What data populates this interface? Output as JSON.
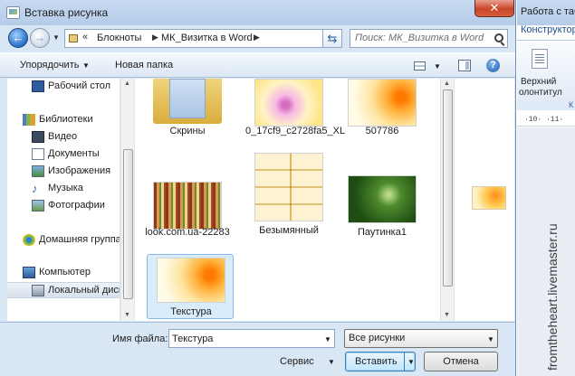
{
  "dialog": {
    "title": "Вставка рисунка",
    "close_label": "✕"
  },
  "address": {
    "prefix": "«",
    "crumbs": [
      "Блокноты",
      "МК_Визитка в Word"
    ],
    "search_placeholder": "Поиск: МК_Визитка в Word"
  },
  "toolbar": {
    "organize_label": "Упорядочить",
    "new_folder_label": "Новая папка",
    "help_label": "?"
  },
  "nav": {
    "items": [
      {
        "label": "Рабочий стол",
        "icon": "desktop-icon"
      },
      {
        "label": "Библиотеки",
        "icon": "libraries-icon"
      },
      {
        "label": "Видео",
        "icon": "video-icon"
      },
      {
        "label": "Документы",
        "icon": "documents-icon"
      },
      {
        "label": "Изображения",
        "icon": "images-icon"
      },
      {
        "label": "Музыка",
        "icon": "music-icon"
      },
      {
        "label": "Фотографии",
        "icon": "photos-icon"
      },
      {
        "label": "Домашняя группа",
        "icon": "homegroup-icon"
      },
      {
        "label": "Компьютер",
        "icon": "computer-icon"
      },
      {
        "label": "Локальный диск",
        "icon": "disk-icon"
      }
    ]
  },
  "files": [
    {
      "name": "Скрины",
      "kind": "folder"
    },
    {
      "name": "0_17cf9_c2728fa5_XL",
      "kind": "image-flowers"
    },
    {
      "name": "507786",
      "kind": "image-orange"
    },
    {
      "name": "look.com.ua-22283",
      "kind": "image-stripes"
    },
    {
      "name": "Безымянный",
      "kind": "image-cards"
    },
    {
      "name": "Паутинка1",
      "kind": "image-green"
    },
    {
      "name": "Текстура",
      "kind": "image-orange",
      "selected": true
    }
  ],
  "bottom": {
    "filename_label": "Имя файла:",
    "filename_value": "Текстура",
    "filetype_value": "Все рисунки",
    "service_label": "Сервис",
    "insert_label": "Вставить",
    "cancel_label": "Отмена"
  },
  "word": {
    "title": "Работа с таб",
    "tab": "Конструктор",
    "cmd1": "Верхний",
    "cmd2": "олонтитул",
    "ribbon_k": "К",
    "ruler": "·10· ·11·"
  },
  "watermark": "fromtheheart.livemaster.ru",
  "colors": {
    "title_bg": "#c7dbf1",
    "selected_bg": "#d9ecfb",
    "close_red": "#c9452a"
  }
}
